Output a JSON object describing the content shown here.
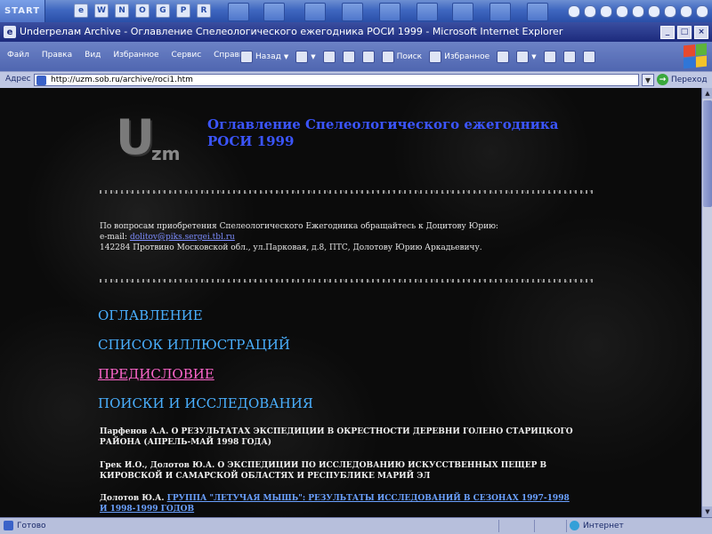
{
  "taskbar": {
    "start_label": "START",
    "quick_launch": [
      "e",
      "W",
      "N",
      "O",
      "G",
      "P",
      "R"
    ]
  },
  "window": {
    "title": "Underрелам Archive - Оглавление Спелеологического ежегодника РОСИ 1999 - Microsoft Internet Explorer"
  },
  "menu": {
    "items": [
      "Файл",
      "Правка",
      "Вид",
      "Избранное",
      "Сервис",
      "Справка"
    ]
  },
  "toolbar": {
    "back_label": "Назад",
    "search_label": "Поиск",
    "favorites_label": "Избранное"
  },
  "address": {
    "label": "Адрес",
    "value": "http://uzm.sob.ru/archive/roci1.htm",
    "go_label": "Переход"
  },
  "page": {
    "logo_letter": "U",
    "logo_sub": "zm",
    "title": "Оглавление Спелеологического ежегодника РОСИ 1999",
    "info_line1": "По вопросам приобретения Спелеологического Ежегодника обращайтесь к Доцитову Юрию:",
    "info_email_prefix": "e-mail:",
    "info_email": "dolitov@piks.sergei.tbl.ru",
    "info_line3": "142284 Протвино Московской обл., ул.Парковая, д.8, ПТС, Долотову Юрию Аркадьевичу.",
    "toc": [
      "ОГЛАВЛЕНИЕ",
      "СПИСОК ИЛЛЮСТРАЦИЙ",
      "ПРЕДИСЛОВИЕ",
      "ПОИСКИ И ИССЛЕДОВАНИЯ"
    ],
    "entries": [
      {
        "text": "Парфенов А.А. О РЕЗУЛЬТАТАХ ЭКСПЕДИЦИИ В ОКРЕСТНОСТИ ДЕРЕВНИ ГОЛЕНО СТАРИЦКОГО РАЙОНА (АПРЕЛЬ-МАЙ 1998 ГОДА)"
      },
      {
        "text": "Грек И.О., Долотов Ю.А. О ЭКСПЕДИЦИИ ПО ИССЛЕДОВАНИЮ ИСКУССТВЕННЫХ ПЕЩЕР В КИРОВСКОЙ И САМАРСКОЙ ОБЛАСТЯХ И РЕСПУБЛИКЕ МАРИЙ ЭЛ"
      },
      {
        "author": "Долотов Ю.А.",
        "link": "ГРУППА \"ЛЕТУЧАЯ МЫШЬ\": РЕЗУЛЬТАТЫ ИССЛЕДОВАНИЙ В СЕЗОНАХ 1997-1998 И 1998-1999 ГОДОВ"
      }
    ]
  },
  "status": {
    "left": "Готово",
    "right": "Интернет"
  }
}
